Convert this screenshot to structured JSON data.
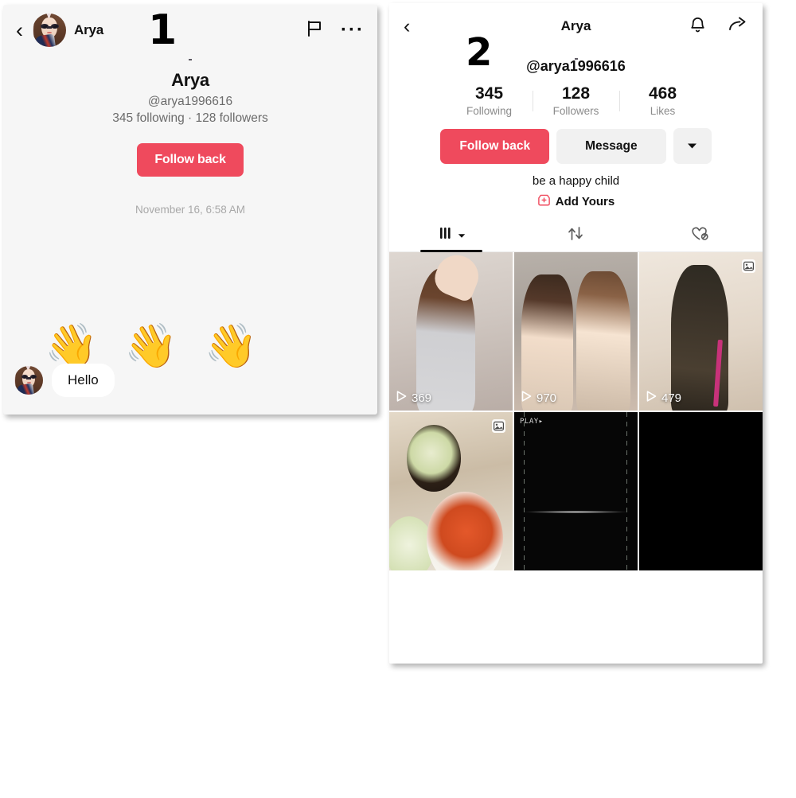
{
  "markers": {
    "one": "1",
    "two": "2"
  },
  "panel1": {
    "header": {
      "back_icon": "chevron-left-icon",
      "name": "Arya",
      "flag_icon": "flag-icon",
      "more_icon": "more-horizontal-icon"
    },
    "profile": {
      "display_name": "Arya",
      "handle": "@arya1996616",
      "counts": "345 following · 128 followers",
      "follow_label": "Follow back"
    },
    "timestamp": "November 16, 6:58 AM",
    "emoji": "👋 👋 👋",
    "message": "Hello"
  },
  "panel2": {
    "header": {
      "back_icon": "chevron-left-icon",
      "title": "Arya",
      "bell_icon": "bell-icon",
      "share_icon": "share-arrow-icon"
    },
    "profile": {
      "handle": "@arya1996616",
      "stats": [
        {
          "num": "345",
          "label": "Following"
        },
        {
          "num": "128",
          "label": "Followers"
        },
        {
          "num": "468",
          "label": "Likes"
        }
      ],
      "follow_label": "Follow back",
      "message_label": "Message",
      "more_icon": "chevron-down-icon",
      "bio": "be a happy child",
      "add_yours_label": "Add Yours",
      "add_yours_icon": "add-yours-plus-icon"
    },
    "tabs": [
      {
        "icon": "grid-posts-icon",
        "caret": "chevron-down-icon",
        "active": true
      },
      {
        "icon": "repost-icon",
        "active": false
      },
      {
        "icon": "liked-private-icon",
        "active": false
      }
    ],
    "grid": [
      {
        "plays": "369",
        "play_icon": "play-triangle-icon",
        "badge": ""
      },
      {
        "plays": "970",
        "play_icon": "play-triangle-icon",
        "badge": ""
      },
      {
        "plays": "479",
        "play_icon": "play-triangle-icon",
        "badge": "photo-icon"
      },
      {
        "plays": "",
        "badge": "photo-icon"
      },
      {
        "plays": "",
        "badge": "",
        "watermark": "PLAY▸"
      },
      {
        "plays": "",
        "badge": ""
      }
    ]
  },
  "colors": {
    "accent": "#ef4a5d",
    "panel1_bg": "#f6f6f6",
    "muted": "#8b8b8b"
  }
}
